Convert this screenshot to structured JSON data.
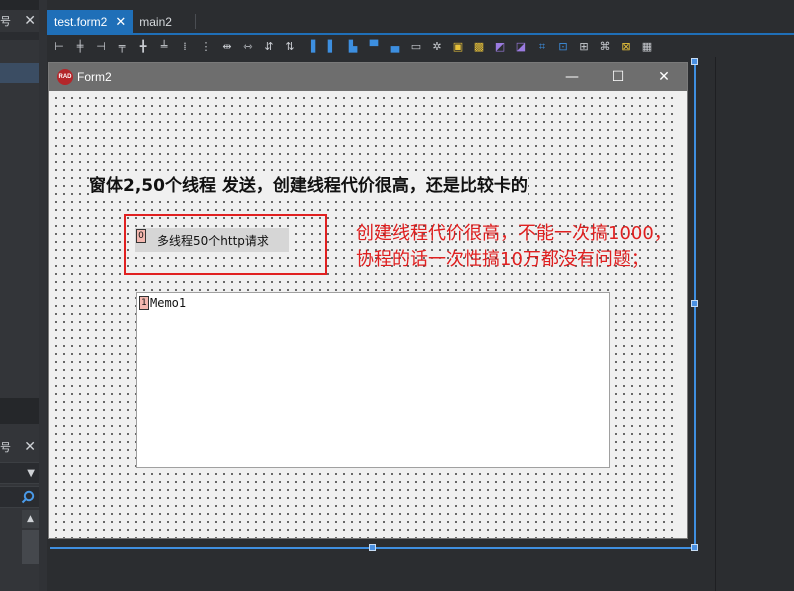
{
  "left_panel": {
    "top_glyph": "号",
    "mid_glyph": "号",
    "close_glyph": "✕"
  },
  "tabs": [
    {
      "label": "test.form2",
      "active": true,
      "close": "✕"
    },
    {
      "label": "main2",
      "active": false
    }
  ],
  "toolbar": {
    "icons": [
      "align-left-icon",
      "align-center-h-icon",
      "align-right-icon",
      "align-top-icon",
      "align-center-v-icon",
      "align-bottom-icon",
      "space-equal-h-icon",
      "space-equal-v-icon",
      "inc-space-h-icon",
      "dec-space-h-icon",
      "inc-space-v-icon",
      "dec-space-v-icon",
      "make-same-width-icon",
      "make-same-height-icon",
      "make-same-size-icon",
      "center-h-icon",
      "center-v-icon",
      "bring-front-icon",
      "send-back-icon",
      "group-icon",
      "ungroup-icon",
      "lock-icon",
      "grid-icon"
    ]
  },
  "form": {
    "icon_text": "RAD",
    "title": "Form2",
    "minimize": "—",
    "maximize": "☐",
    "close": "✕",
    "heading": "窗体2,50个线程 发送，创建线程代价很高，还是比较卡的",
    "button": {
      "index": "0",
      "label": "多线程50个http请求"
    },
    "note": "创建线程代价很高，不能一次搞1000，协程的话一次性搞10万都没有问题；",
    "memo": {
      "index": "1",
      "text": "Memo1"
    }
  }
}
